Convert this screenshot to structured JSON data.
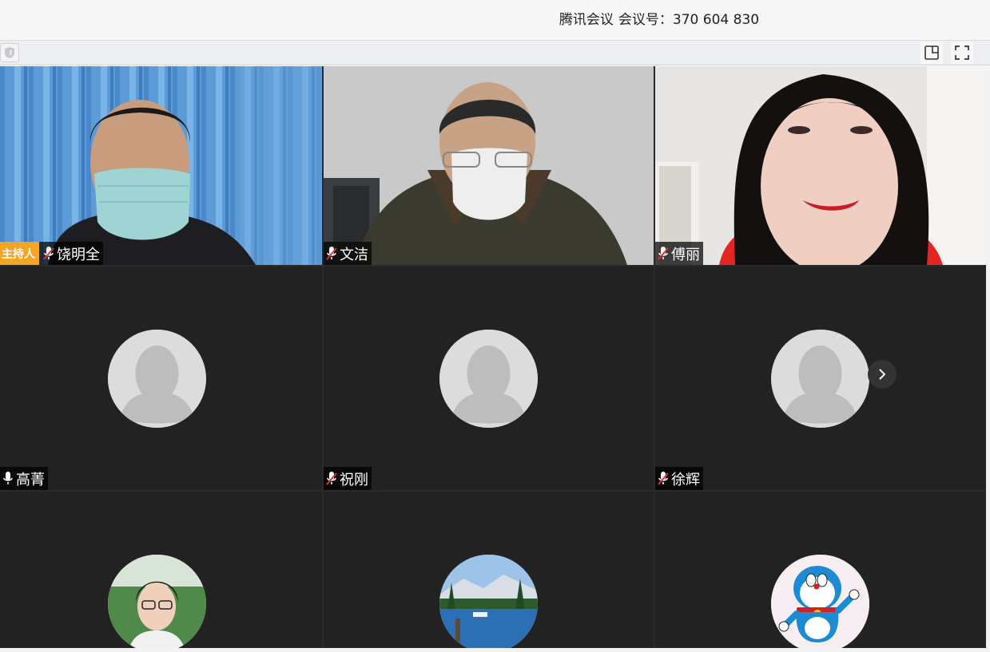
{
  "window": {
    "app_name": "腾讯会议",
    "meeting_label": "会议号：370 604 830"
  },
  "toolbar": {
    "shield_icon": "shield-icon",
    "layout_icon": "layout-toggle-icon",
    "fullscreen_icon": "fullscreen-icon"
  },
  "participants": [
    {
      "name": "饶明全",
      "host_label": "主持人",
      "mic": "muted",
      "video": true
    },
    {
      "name": "文洁",
      "mic": "muted",
      "video": true
    },
    {
      "name": "傅丽",
      "mic": "muted",
      "video": true
    },
    {
      "name": "高菁",
      "mic": "on",
      "video": false,
      "avatar": "default-person"
    },
    {
      "name": "祝刚",
      "mic": "muted",
      "video": false,
      "avatar": "default-person"
    },
    {
      "name": "徐辉",
      "mic": "muted",
      "video": false,
      "avatar": "default-person"
    },
    {
      "video": false,
      "avatar": "woman-photo"
    },
    {
      "video": false,
      "avatar": "lake-landscape"
    },
    {
      "video": false,
      "avatar": "doraemon"
    }
  ],
  "colors": {
    "host_badge": "#f4a523",
    "tile_bg": "#222222",
    "mic_muted_red": "#e0333b"
  }
}
